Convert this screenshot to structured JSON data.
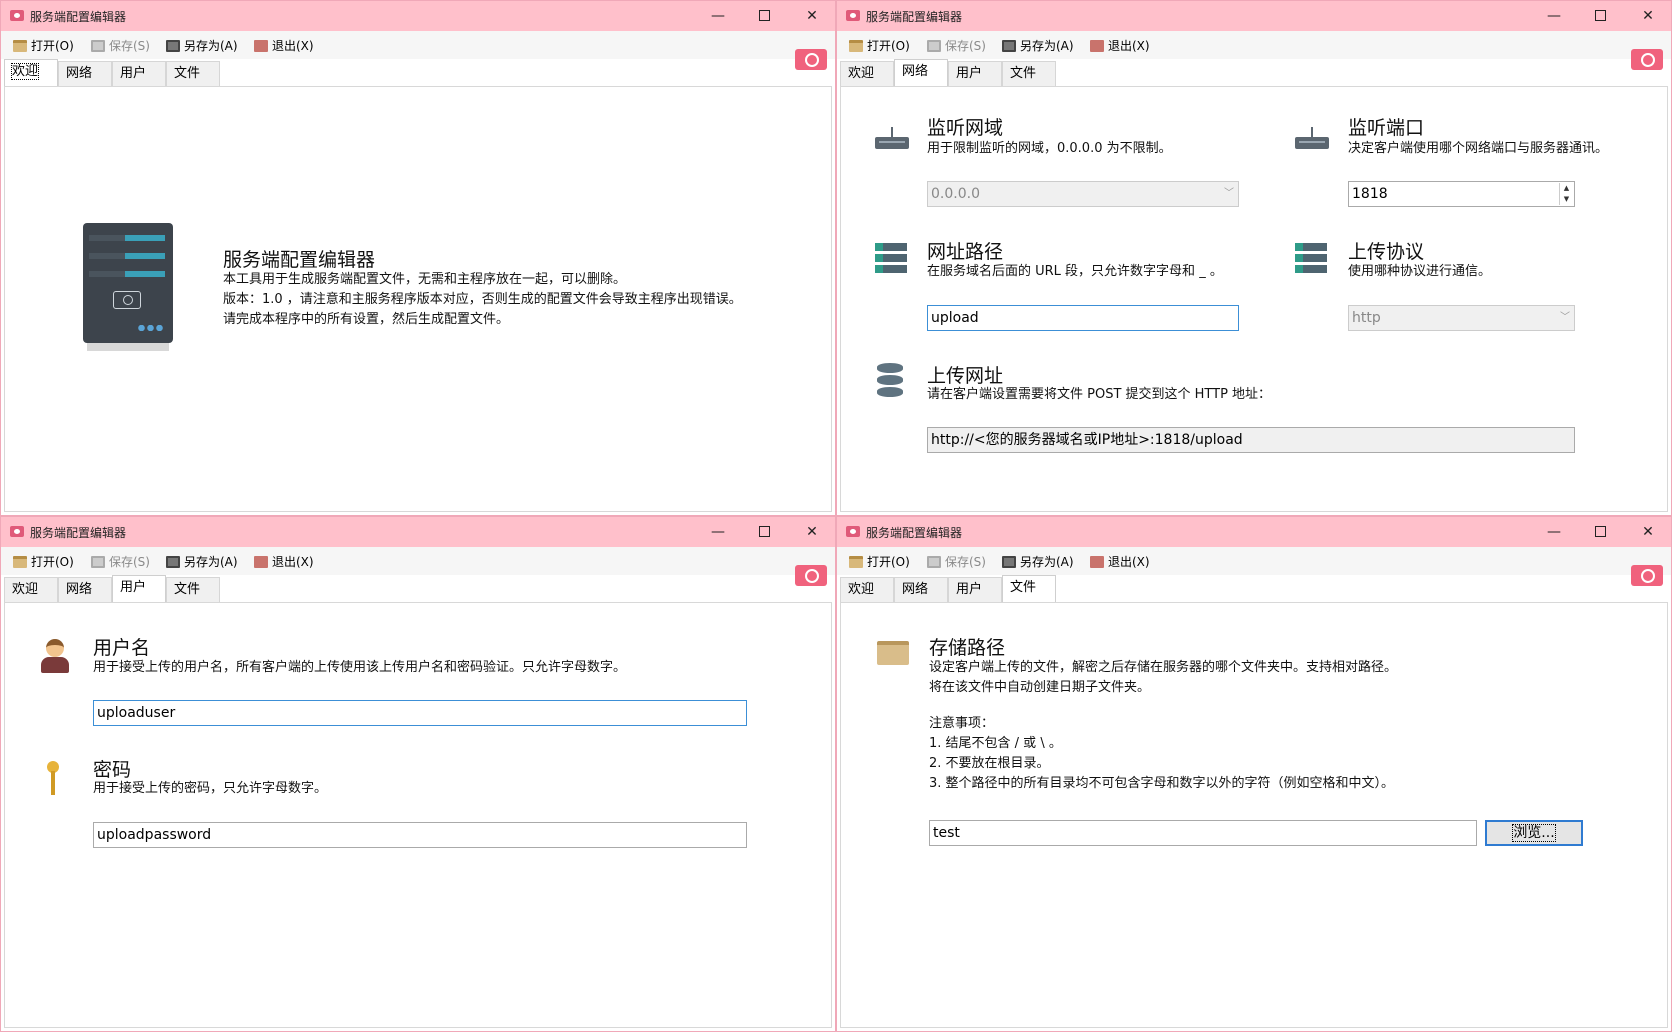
{
  "app": {
    "title": "服务端配置编辑器",
    "minimize": "—",
    "close": "✕"
  },
  "toolbar": {
    "open": "打开(O)",
    "save": "保存(S)",
    "save_as": "另存为(A)",
    "exit": "退出(X)"
  },
  "tabs": [
    "欢迎",
    "网络",
    "用户",
    "文件"
  ],
  "welcome": {
    "heading": "服务端配置编辑器",
    "line1": "本工具用于生成服务端配置文件，无需和主程序放在一起，可以删除。",
    "line2": "版本：1.0 ，请注意和主服务程序版本对应，否则生成的配置文件会导致主程序出现错误。",
    "line3": "请完成本程序中的所有设置，然后生成配置文件。"
  },
  "network": {
    "listen_domain": {
      "title": "监听网域",
      "desc": "用于限制监听的网域，0.0.0.0 为不限制。",
      "value": "0.0.0.0"
    },
    "listen_port": {
      "title": "监听端口",
      "desc": "决定客户端使用哪个网络端口与服务器通讯。",
      "value": "1818"
    },
    "url_path": {
      "title": "网址路径",
      "desc": "在服务域名后面的 URL 段，只允许数字字母和 _ 。",
      "value": "upload"
    },
    "upload_protocol": {
      "title": "上传协议",
      "desc": "使用哪种协议进行通信。",
      "value": "http"
    },
    "upload_url": {
      "title": "上传网址",
      "desc": "请在客户端设置需要将文件 POST 提交到这个 HTTP 地址：",
      "value": "http://<您的服务器域名或IP地址>:1818/upload"
    }
  },
  "user": {
    "username": {
      "title": "用户名",
      "desc": "用于接受上传的用户名，所有客户端的上传使用该上传用户名和密码验证。只允许字母数字。",
      "value": "uploaduser"
    },
    "password": {
      "title": "密码",
      "desc": "用于接受上传的密码，只允许字母数字。",
      "value": "uploadpassword"
    }
  },
  "file": {
    "title": "存储路径",
    "desc1": "设定客户端上传的文件，解密之后存储在服务器的哪个文件夹中。支持相对路径。",
    "desc2": "将在该文件中自动创建日期子文件夹。",
    "notes_title": "注意事项：",
    "note1": "1. 结尾不包含 / 或 \\ 。",
    "note2": "2. 不要放在根目录。",
    "note3": "3. 整个路径中的所有目录均不可包含字母和数字以外的字符（例如空格和中文）。",
    "value": "test",
    "browse": "浏览..."
  }
}
